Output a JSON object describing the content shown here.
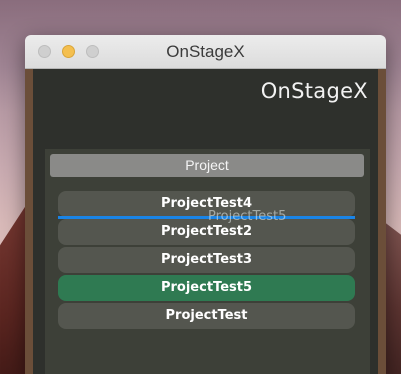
{
  "window": {
    "title": "OnStageX"
  },
  "app": {
    "brand": "OnStageX"
  },
  "panel": {
    "header": "Project",
    "items": [
      {
        "label": "ProjectTest4",
        "selected": false
      },
      {
        "label": "ProjectTest2",
        "selected": false
      },
      {
        "label": "ProjectTest3",
        "selected": false
      },
      {
        "label": "ProjectTest5",
        "selected": true
      },
      {
        "label": "ProjectTest",
        "selected": false
      }
    ],
    "drag_ghost": "ProjectTest5"
  },
  "colors": {
    "selected_item": "#2f7a52",
    "drop_indicator": "#1a84e6"
  }
}
